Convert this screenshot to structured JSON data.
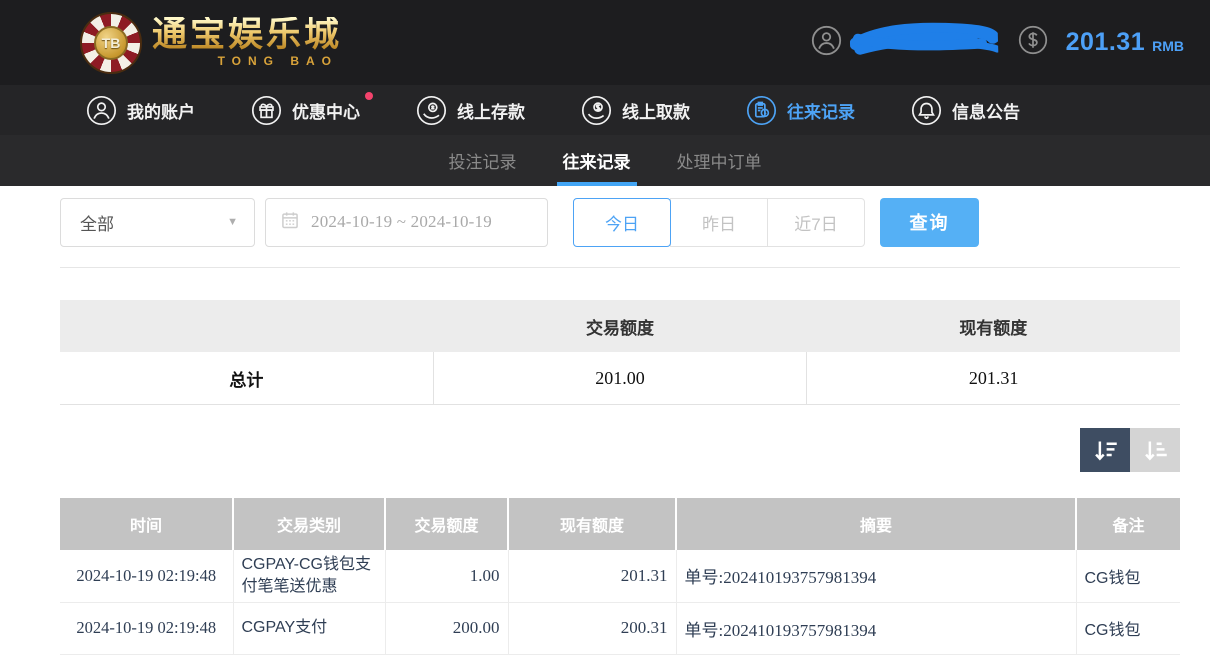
{
  "header": {
    "logo": {
      "chip_text": "TB",
      "title": "通宝娱乐城",
      "subtitle": "TONG BAO"
    },
    "balance": {
      "amount": "201.31",
      "currency": "RMB"
    }
  },
  "nav": {
    "items": [
      {
        "label": "我的账户",
        "active": false,
        "badge": false
      },
      {
        "label": "优惠中心",
        "active": false,
        "badge": true
      },
      {
        "label": "线上存款",
        "active": false,
        "badge": false
      },
      {
        "label": "线上取款",
        "active": false,
        "badge": false
      },
      {
        "label": "往来记录",
        "active": true,
        "badge": false
      },
      {
        "label": "信息公告",
        "active": false,
        "badge": false
      }
    ]
  },
  "tabs": {
    "items": [
      {
        "label": "投注记录",
        "active": false
      },
      {
        "label": "往来记录",
        "active": true
      },
      {
        "label": "处理中订单",
        "active": false
      }
    ]
  },
  "filters": {
    "type_select": {
      "value": "全部"
    },
    "date_range": {
      "value": "2024-10-19 ~ 2024-10-19"
    },
    "quick_buttons": [
      {
        "label": "今日",
        "active": true
      },
      {
        "label": "昨日",
        "active": false
      },
      {
        "label": "近7日",
        "active": false
      }
    ],
    "search_button": "查询"
  },
  "summary": {
    "columns": [
      "",
      "交易额度",
      "现有额度"
    ],
    "total_row": {
      "label": "总计",
      "transaction_amount": "201.00",
      "current_amount": "201.31"
    }
  },
  "records_table": {
    "headers": [
      "时间",
      "交易类别",
      "交易额度",
      "现有额度",
      "摘要",
      "备注"
    ],
    "rows": [
      {
        "time": "2024-10-19 02:19:48",
        "category": "CGPAY-CG钱包支付笔笔送优惠",
        "amount": "1.00",
        "balance": "201.31",
        "summary": "单号:202410193757981394",
        "remark": "CG钱包"
      },
      {
        "time": "2024-10-19 02:19:48",
        "category": "CGPAY支付",
        "amount": "200.00",
        "balance": "200.31",
        "summary": "单号:202410193757981394",
        "remark": "CG钱包"
      }
    ]
  },
  "colors": {
    "accent_blue": "#4da3f5",
    "search_button_blue": "#55b0f5",
    "balance_blue": "#4da0f7",
    "header_bg": "#1d1d1f",
    "nav_bg": "#252527",
    "tab_bg": "#2a2a2c",
    "table_header_gray": "#c3c3c3",
    "sort_active_bg": "#3e4d62",
    "notification_red": "#f4436c",
    "logo_gold": "#e3b85e"
  }
}
